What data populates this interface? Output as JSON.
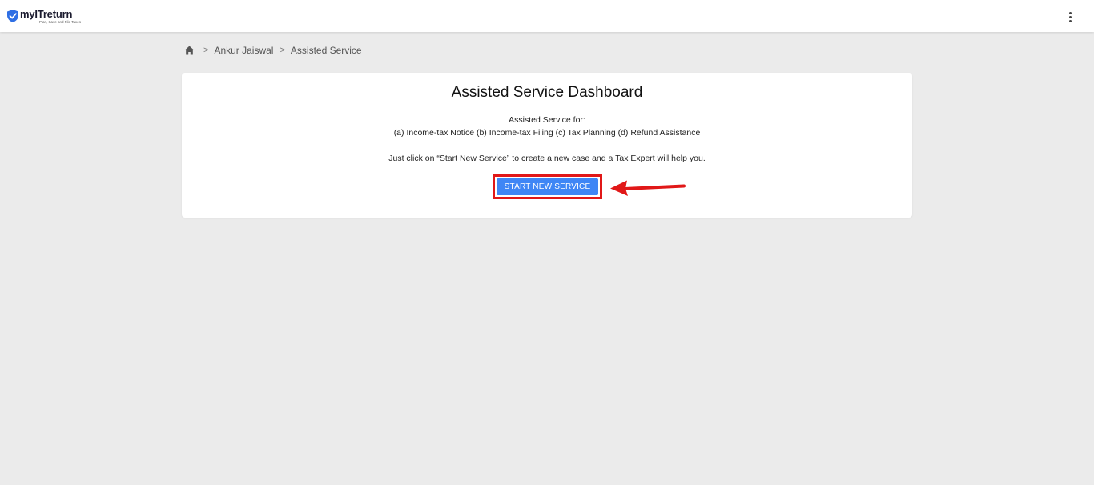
{
  "header": {
    "logo_name": "myITreturn",
    "logo_tagline": "Plan, Save and File Taxes",
    "menu_icon": "more-vertical-icon"
  },
  "breadcrumb": {
    "home_icon": "home-icon",
    "separator": ">",
    "items": [
      "Ankur Jaiswal",
      "Assisted Service"
    ]
  },
  "dashboard": {
    "title": "Assisted Service Dashboard",
    "intro": "Assisted Service for:",
    "services": "(a) Income-tax Notice (b) Income-tax Filing (c) Tax Planning (d) Refund Assistance",
    "instruction": "Just click on “Start New Service” to create a new case and a Tax Expert will help you.",
    "button_label": "START NEW SERVICE"
  },
  "annotation": {
    "highlight_color": "#e11818",
    "arrow_icon": "arrow-left-icon"
  },
  "colors": {
    "primary": "#3f86f5",
    "background": "#ebebeb",
    "logo_blue": "#2f6fe4"
  }
}
